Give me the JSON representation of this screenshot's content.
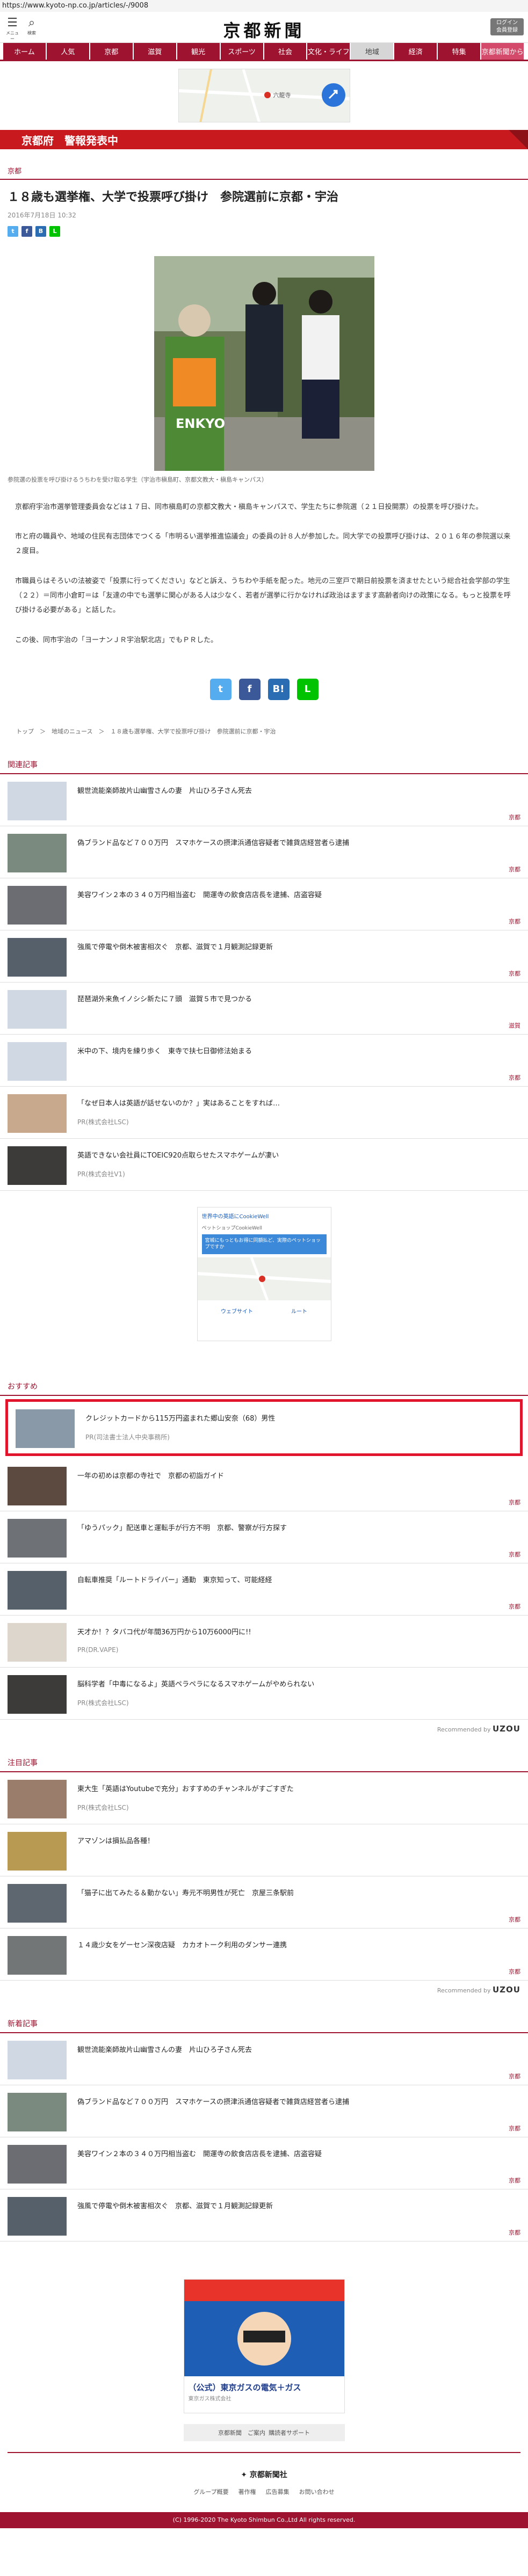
{
  "url": "https://www.kyoto-np.co.jp/articles/-/9008",
  "header": {
    "menu_label": "メニュー",
    "search_label": "検索",
    "logo": "京都新聞",
    "login_label": "ログイン\n会員登録"
  },
  "nav": [
    {
      "label": "ホーム"
    },
    {
      "label": "人気"
    },
    {
      "label": "京都"
    },
    {
      "label": "滋賀"
    },
    {
      "label": "観光"
    },
    {
      "label": "スポーツ"
    },
    {
      "label": "社会"
    },
    {
      "label": "文化・ライフ"
    },
    {
      "label": "地域"
    },
    {
      "label": "経済"
    },
    {
      "label": "特集"
    },
    {
      "label": "京都新聞から"
    }
  ],
  "top_ad": {
    "place": "六龍寺"
  },
  "alert": {
    "text": "京都府　警報発表中"
  },
  "article": {
    "section": "京都",
    "title": "１８歳も選挙権、大学で投票呼び掛け　参院選前に京都・宇治",
    "date": "2016年7月18日 10:32",
    "caption": "参院選の投票を呼び掛けるうちわを受け取る学生（宇治市槇島町、京都文教大・槇島キャンパス）",
    "paragraphs": [
      "京都府宇治市選挙管理委員会などは１７日、同市槇島町の京都文教大・槇島キャンパスで、学生たちに参院選（２１日投開票）の投票を呼び掛けた。",
      "市と府の職員や、地域の住民有志団体でつくる「市明るい選挙推進協議会」の委員の計８人が参加した。同大学での投票呼び掛けは、２０１６年の参院選以来２度目。",
      "市職員らはそろいの法被姿で「投票に行ってください」などと訴え、うちわや手紙を配った。地元の三室戸で期日前投票を済ませたという総合社会学部の学生（２２）＝同市小倉町＝は「友達の中でも選挙に関心がある人は少なく、若者が選挙に行かなければ政治はますます高齢者向けの政策になる。もっと投票を呼び掛ける必要がある」と話した。",
      "この後、同市宇治の「ヨーナンＪＲ宇治駅北店」でもＰＲした。"
    ],
    "breadcrumb": "トップ　＞　地域のニュース　＞　１８歳も選挙権、大学で投票呼び掛け　参院選前に京都・宇治"
  },
  "related": {
    "heading": "関連記事",
    "items": [
      {
        "title": "観世流能楽師故片山幽雪さんの妻　片山ひろ子さん死去",
        "cat": "京都"
      },
      {
        "title": "偽ブランド品など７００万円　スマホケースの摂津浜通信容疑者で雑貨店経営者ら逮捕",
        "cat": "京都"
      },
      {
        "title": "美容ワイン２本の３４０万円相当盗む　開運寺の飲食店店長を逮捕、店盗容疑",
        "cat": "京都"
      },
      {
        "title": "強風で停電や倒木被害相次ぐ　京都、滋賀で１月観測記録更新",
        "cat": "京都"
      },
      {
        "title": "琵琶湖外来魚イノシシ新たに７頭　滋賀５市で見つかる",
        "cat": "滋賀"
      },
      {
        "title": "米中の下、境内を練り歩く　東寺で扶七日御修法始まる",
        "cat": "京都"
      }
    ],
    "pr_items": [
      {
        "title": "「なぜ日本人は英語が話せないのか？」実はあることをすれば…",
        "pr": "PR(株式会社LSC)"
      },
      {
        "title": "英語できない会社員にTOEIC920点取らせたスマホゲームが凄い",
        "pr": "PR(株式会社V1)"
      }
    ]
  },
  "map_ad": {
    "shop": "世界中の英語にCookieWell",
    "sub": "ペットショップCookieWell",
    "desc": "宮城にもっともお得に同額払ど、実際のペットショップですか",
    "map_label": "ウェブサイト",
    "route_label": "ルート"
  },
  "recommend": {
    "heading": "おすすめ",
    "highlight": {
      "title": "クレジットカードから115万円盗まれた郷山安奈（68）男性",
      "pr": "PR(司法書士法人中央事務所)"
    },
    "items": [
      {
        "title": "一年の初めは京都の寺社で　京都の初詣ガイド",
        "cat": "京都"
      },
      {
        "title": "「ゆうパック」配送車と運転手が行方不明　京都、警察が行方探す",
        "cat": "京都"
      },
      {
        "title": "自転車推奨「ルートドライバー」通勤　東京知って、可能経経",
        "cat": "京都"
      }
    ],
    "pr_items": [
      {
        "title": "天才か！？タバコ代が年間36万円から10万6000円に!!",
        "pr": "PR(DR.VAPE)"
      },
      {
        "title": "脳科学者「中毒になるよ」英語ペラペラになるスマホゲームがやめられない",
        "pr": "PR(株式会社LSC)"
      }
    ],
    "recommended_by": "Recommended by",
    "brand": "UZOU"
  },
  "popular": {
    "heading": "注目記事",
    "pr_items": [
      {
        "title": "東大生「英語はYoutubeで充分」おすすめのチャンネルがすごすぎた",
        "pr": "PR(株式会社LSC)"
      },
      {
        "title": "アマゾンは損払品各種！",
        "pr": ""
      }
    ],
    "items": [
      {
        "title": "「猫子に出てみたる＆動かない」寿元不明男性が死亡　京屋三条駅前",
        "cat": "京都"
      },
      {
        "title": "１４歳少女をゲーセン深夜店疑　カカオトーク利用のダンサー連携",
        "cat": "京都"
      }
    ],
    "recommended_by": "Recommended by",
    "brand": "UZOU"
  },
  "new_articles": {
    "heading": "新着記事",
    "items": [
      {
        "title": "観世流能楽師故片山幽雪さんの妻　片山ひろ子さん死去",
        "cat": "京都"
      },
      {
        "title": "偽ブランド品など７００万円　スマホケースの摂津浜通信容疑者で雑貨店経営者ら逮捕",
        "cat": "京都"
      },
      {
        "title": "美容ワイン２本の３４０万円相当盗む　開運寺の飲食店店長を逮捕、店盗容疑",
        "cat": "京都"
      },
      {
        "title": "強風で停電や倒木被害相次ぐ　京都、滋賀で１月観測記録更新",
        "cat": "京都"
      }
    ]
  },
  "bottom_ad": {
    "title": "（公式）東京ガスの電気＋ガス",
    "sub": "東京ガス株式会社"
  },
  "footer": {
    "links": [
      "京都新聞　ご案内",
      "購読者サポート"
    ],
    "brand": "京都新聞社",
    "nav": [
      "グループ概要",
      "著作権",
      "広告募集",
      "お問い合わせ"
    ],
    "copyright": "(C) 1996-2020 The Kyoto Shimbun Co.,Ltd All rights reserved."
  }
}
